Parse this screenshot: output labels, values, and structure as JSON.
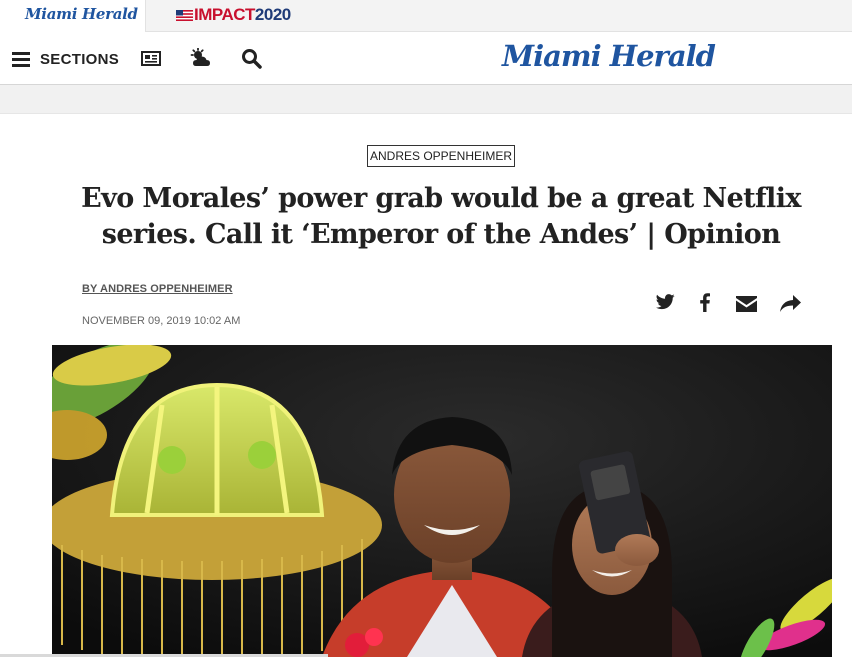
{
  "top_bar": {
    "site_tab": "Miami Herald",
    "impact_word": "IMPACT",
    "impact_year": "2020"
  },
  "header": {
    "sections_label": "SECTIONS",
    "logo_text": "Miami Herald",
    "icons": [
      "menu-icon",
      "e-edition-icon",
      "weather-icon",
      "search-icon"
    ]
  },
  "article": {
    "kicker": "ANDRES OPPENHEIMER",
    "headline": "Evo Morales’ power grab would be a great Netflix series. Call it ‘Emperor of the Andes’ | Opinion",
    "byline": "BY ANDRES OPPENHEIMER",
    "dateline": "NOVEMBER 09, 2019 10:02 AM",
    "share_icons": [
      "twitter-icon",
      "facebook-icon",
      "email-icon",
      "share-icon"
    ]
  },
  "colors": {
    "brand_blue": "#1f55a0",
    "impact_red": "#c8102e",
    "impact_navy": "#1f3b78",
    "text_dark": "#222222"
  }
}
